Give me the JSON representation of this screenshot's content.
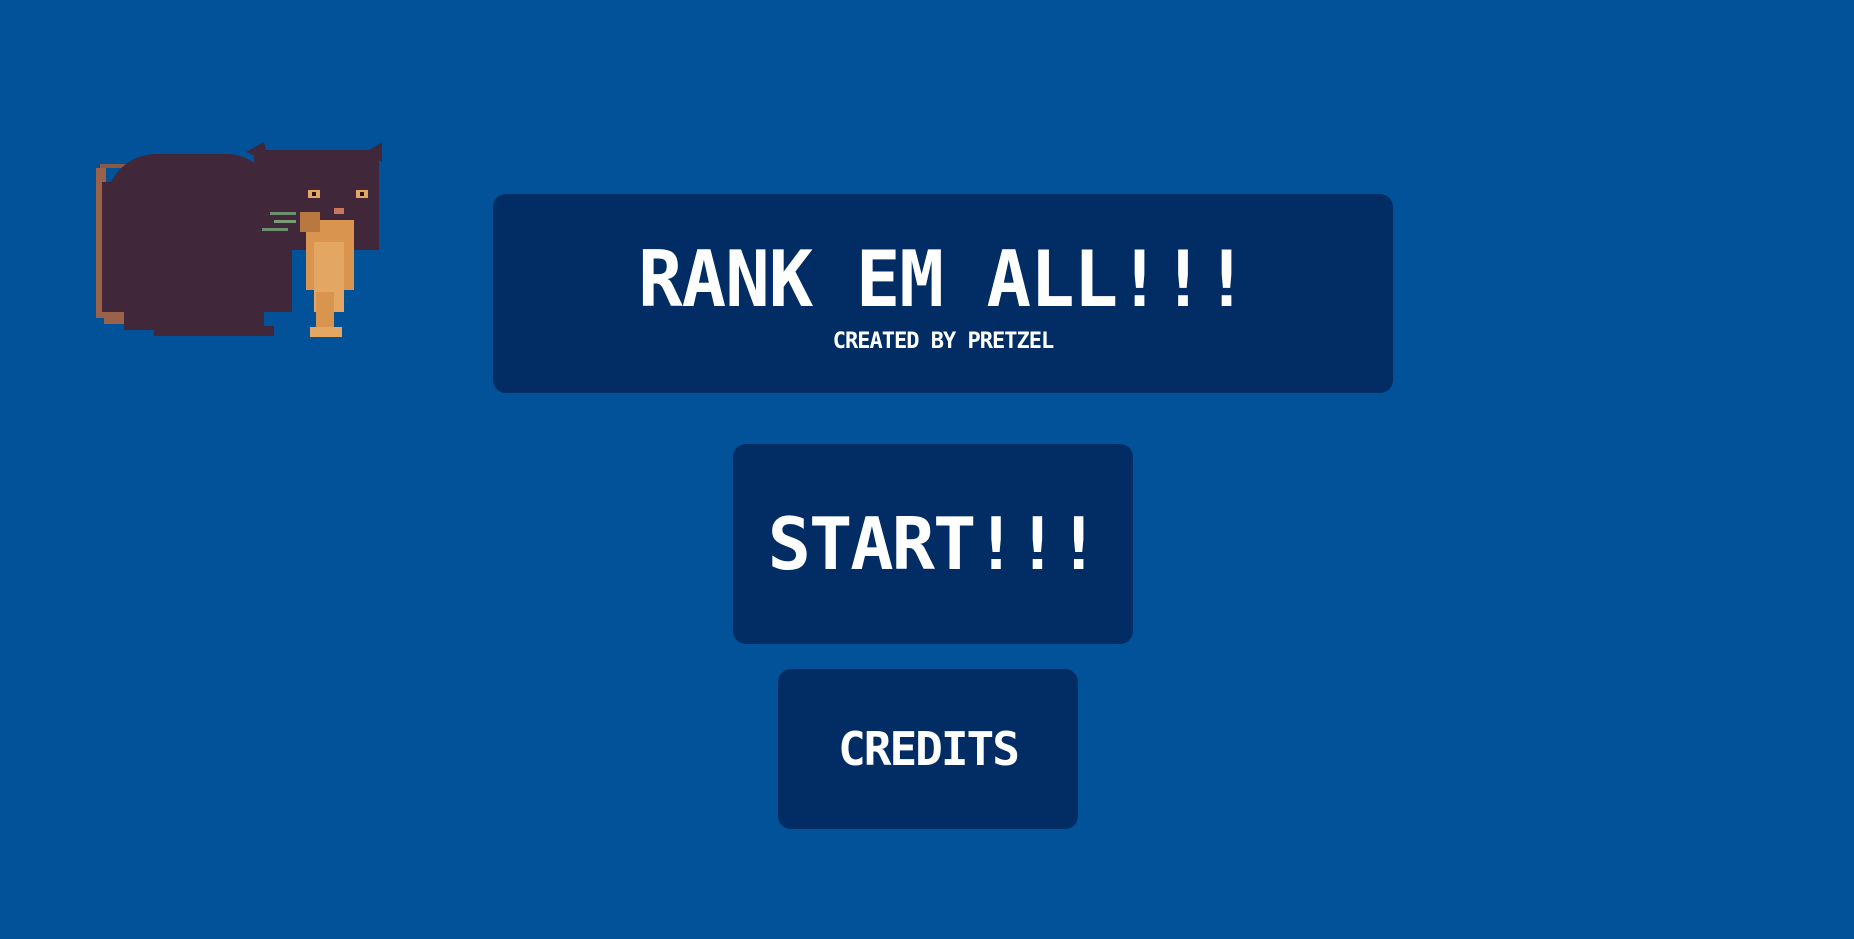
{
  "game": {
    "title": "RANK EM ALL!!!",
    "subtitle": "CREATED BY PRETZEL"
  },
  "menu": {
    "start_label": "START!!!",
    "credits_label": "CREDITS"
  },
  "mascot": {
    "icon": "pixel-cat-icon"
  },
  "colors": {
    "background": "#02529a",
    "panel": "#012d64",
    "text": "#ffffff",
    "cat_body": "#40283a",
    "cat_accent": "#e0a060"
  }
}
